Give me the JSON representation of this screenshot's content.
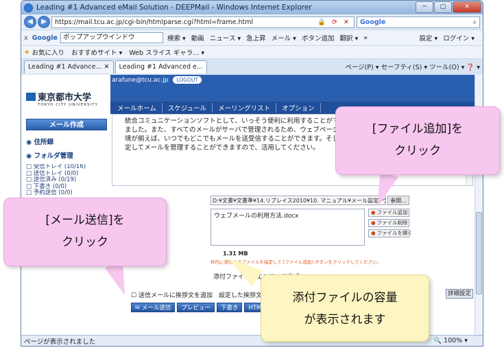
{
  "window": {
    "title": "Leading #1 Advanced eMail Solution - DEEPMail - Windows Internet Explorer",
    "minimize": "─",
    "maximize": "□",
    "close": "✕"
  },
  "address": {
    "url": "https://mail.tcu.ac.jp/cgi-bin/htmlparse.cgi?html=frame.html",
    "status_icons": "🔒 ⟳ ✕",
    "search_engine": "Google",
    "search_placeholder": ""
  },
  "google_toolbar": {
    "close": "x",
    "logo": "Google",
    "query": "ポップアップウインドウ",
    "items": [
      "検索 ▾",
      "動画",
      "ニュース ▾",
      "急上昇",
      "メール ▾",
      "ボタン追加",
      "翻訳 ▾",
      "»"
    ],
    "settings": "設定 ▾",
    "login": "ログイン ▾"
  },
  "favorites_bar": {
    "favorites": "お気に入り",
    "items": [
      "おすすめサイト ▾",
      "Web スライス ギャラ... ▾"
    ]
  },
  "tabs": {
    "items": [
      "Leading #1 Advance... ✕",
      "Leading #1 Advanced e..."
    ],
    "tools": "ページ(P) ▾  セーフティ(S) ▾  ツール(O) ▾  ❓ ▾"
  },
  "sidebar": {
    "logo_jp": "東京都市大学",
    "logo_en": "TOKYO CITY UNIVERSITY",
    "compose_label": "メール作成",
    "address_book": "住所録",
    "folder_manage": "フォルダ管理",
    "folders": [
      "受信トレイ (10/16)",
      "送信トレイ (0/0)",
      "送信済み (0/19)",
      "下書き (0/0)",
      "予約送信 (0/0)"
    ]
  },
  "main": {
    "user": "arafune@tcu.ac.jp",
    "logout": "LOGOUT",
    "menu": [
      "メールホーム",
      "スケジュール",
      "メーリングリスト",
      "オプション"
    ],
    "body_lines": [
      "統合コミュニケーションソフトとして、いっそう便利に利用することができるように",
      "ました。また、すべてのメールがサーバで管理されるため、ウェブページを閲覧でき",
      "境が揃えば、いつでもどこでもメールを送受信することができます。そして、何より",
      "定してメールを管理することができますので、活用してください。"
    ],
    "attach_path": "D:¥文書¥文書準¥14.リプレイス2010¥10. マニュアル¥メール設定¥ウェブメールの",
    "browse_label": "参照...",
    "attached_file": "ウェブメールの利用方法.docx",
    "attach_buttons": [
      "ファイル追加",
      "ファイル削除",
      "ファイルを開く"
    ],
    "attach_size": "1.31 MB",
    "attach_warning": "枠内に添付するファイルを指定して [ファイル追加] ボタンをクリックしてください。",
    "encoding_label": "添付ファイルのエンコード方式",
    "greeting_label": "送信メールに挨拶文を追加",
    "greeting_hint": "設定した挨拶文が本文の最後に挿入されます",
    "detail_button": "詳細設定",
    "bottom_buttons": [
      "メール送信",
      "プレビュー",
      "下書き",
      "HTML作成"
    ]
  },
  "status": {
    "text": "ページが表示されました",
    "zoom": "🔍 100% ▾"
  },
  "callouts": {
    "add_file_line1": "[ファイル追加]を",
    "add_file_line2": "クリック",
    "send_line1": "[メール送信]を",
    "send_line2": "クリック",
    "size_line1": "添付ファイルの容量",
    "size_line2": "が表示されます"
  }
}
